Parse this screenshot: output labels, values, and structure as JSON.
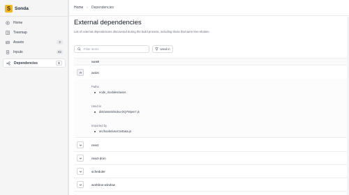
{
  "app": {
    "name": "Sonda",
    "logo_letter": "S",
    "logo_color": "#f5b716"
  },
  "sidebar": {
    "items": [
      {
        "label": "Home",
        "icon": "home-icon",
        "count": null
      },
      {
        "label": "Treemap",
        "icon": "treemap-icon",
        "count": null
      },
      {
        "label": "Assets",
        "icon": "assets-icon",
        "count": "3"
      },
      {
        "label": "Inputs",
        "icon": "inputs-icon",
        "count": "82"
      },
      {
        "label": "Dependencies",
        "icon": "share-icon",
        "count": "5",
        "active": true
      }
    ]
  },
  "breadcrumb": {
    "home": "Home",
    "current": "Dependencies"
  },
  "page": {
    "title": "External dependencies",
    "description": "List of external dependencies discovered during the build process, including those that were tree-shaken."
  },
  "search": {
    "placeholder": "Filter items",
    "value": ""
  },
  "filter": {
    "label": "Used in"
  },
  "table": {
    "header": "NAME",
    "rows": [
      {
        "name": "axios",
        "expanded": true
      },
      {
        "name": "react",
        "expanded": false
      },
      {
        "name": "react-dom",
        "expanded": false
      },
      {
        "name": "scheduler",
        "expanded": false
      },
      {
        "name": "workbox-window",
        "expanded": false
      }
    ]
  },
  "details": {
    "paths_label": "Paths",
    "paths": [
      "node_modules/axios"
    ],
    "used_in_label": "Used in",
    "used_in": [
      "dist/assets/index-DQ7Wjwn7.js"
    ],
    "imported_by_label": "Imported by",
    "imported_by": [
      "src/hooks/useCsvData.js"
    ]
  }
}
